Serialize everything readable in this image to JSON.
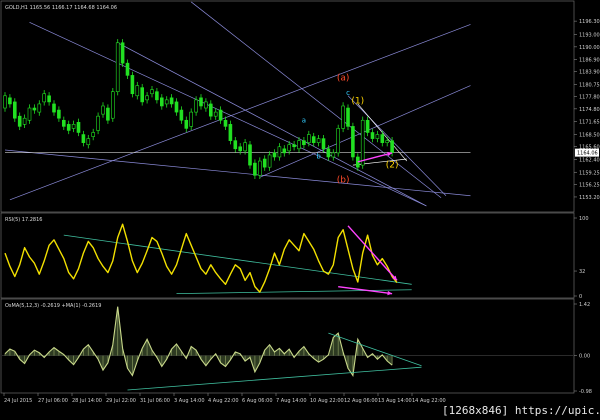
{
  "chart_data": [
    {
      "type": "candlestick",
      "title": "GOLD,H1  1165.56 1166.17 1164.68 1164.06",
      "ylim": [
        1150.0,
        1200.5
      ],
      "yticks": [
        1153.2,
        1156.25,
        1159.25,
        1162.4,
        1165.6,
        1168.5,
        1171.65,
        1174.8,
        1177.8,
        1180.75,
        1183.9,
        1186.9,
        1190.0,
        1193.0,
        1196.3
      ],
      "grid": false,
      "current_price": 1164.06,
      "current_price_label": "1164.06",
      "wave_labels": [
        {
          "text": "(a)",
          "color": "#ff4a2a",
          "bar": 69,
          "price": 1181.8
        },
        {
          "text": "c",
          "color": "#33ccff",
          "bar": 70,
          "price": 1178.2
        },
        {
          "text": "a",
          "color": "#33ccff",
          "bar": 61,
          "price": 1171.5
        },
        {
          "text": "b",
          "color": "#33ccff",
          "bar": 64,
          "price": 1162.6
        },
        {
          "text": "(b)",
          "color": "#ff4a2a",
          "bar": 69,
          "price": 1156.7
        },
        {
          "text": "(1)",
          "color": "#ffd400",
          "bar": 72,
          "price": 1176.1
        },
        {
          "text": "(2)",
          "color": "#ffd400",
          "bar": 79,
          "price": 1160.4
        }
      ],
      "bars": [
        {
          "o": 1175.0,
          "c": 1178.0
        },
        {
          "o": 1177.5,
          "c": 1176.0
        },
        {
          "o": 1176.5,
          "c": 1172.5
        },
        {
          "o": 1173.0,
          "c": 1170.5
        },
        {
          "o": 1171.0,
          "c": 1172.5
        },
        {
          "o": 1172.0,
          "c": 1175.0
        },
        {
          "o": 1175.0,
          "c": 1174.5
        },
        {
          "o": 1174.0,
          "c": 1176.0
        },
        {
          "o": 1176.5,
          "c": 1178.5
        },
        {
          "o": 1178.0,
          "c": 1176.5
        },
        {
          "o": 1176.0,
          "c": 1174.0
        },
        {
          "o": 1174.5,
          "c": 1172.5
        },
        {
          "o": 1172.0,
          "c": 1170.5
        },
        {
          "o": 1171.0,
          "c": 1169.5
        },
        {
          "o": 1170.0,
          "c": 1171.0
        },
        {
          "o": 1171.5,
          "c": 1169.0
        },
        {
          "o": 1168.5,
          "c": 1166.5
        },
        {
          "o": 1166.0,
          "c": 1167.5
        },
        {
          "o": 1168.0,
          "c": 1169.0
        },
        {
          "o": 1169.5,
          "c": 1173.0
        },
        {
          "o": 1173.5,
          "c": 1175.5
        },
        {
          "o": 1175.0,
          "c": 1172.0
        },
        {
          "o": 1172.5,
          "c": 1179.0
        },
        {
          "o": 1179.0,
          "c": 1191.0
        },
        {
          "o": 1191.0,
          "c": 1186.0
        },
        {
          "o": 1186.0,
          "c": 1183.0
        },
        {
          "o": 1183.0,
          "c": 1178.5
        },
        {
          "o": 1178.0,
          "c": 1180.5
        },
        {
          "o": 1180.0,
          "c": 1176.5
        },
        {
          "o": 1177.0,
          "c": 1178.0
        },
        {
          "o": 1178.5,
          "c": 1179.5
        },
        {
          "o": 1179.0,
          "c": 1177.0
        },
        {
          "o": 1177.5,
          "c": 1175.5
        },
        {
          "o": 1176.0,
          "c": 1177.0
        },
        {
          "o": 1177.5,
          "c": 1176.0
        },
        {
          "o": 1176.5,
          "c": 1174.0
        },
        {
          "o": 1174.5,
          "c": 1172.0
        },
        {
          "o": 1172.0,
          "c": 1170.0
        },
        {
          "o": 1170.5,
          "c": 1174.0
        },
        {
          "o": 1174.0,
          "c": 1177.0
        },
        {
          "o": 1177.5,
          "c": 1175.5
        },
        {
          "o": 1175.0,
          "c": 1176.5
        },
        {
          "o": 1176.0,
          "c": 1173.0
        },
        {
          "o": 1173.0,
          "c": 1174.0
        },
        {
          "o": 1174.5,
          "c": 1172.0
        },
        {
          "o": 1172.0,
          "c": 1170.5
        },
        {
          "o": 1171.0,
          "c": 1167.0
        },
        {
          "o": 1167.0,
          "c": 1165.0
        },
        {
          "o": 1165.5,
          "c": 1164.5
        },
        {
          "o": 1164.5,
          "c": 1166.5
        },
        {
          "o": 1166.0,
          "c": 1161.0
        },
        {
          "o": 1161.5,
          "c": 1158.5
        },
        {
          "o": 1158.5,
          "c": 1162.0
        },
        {
          "o": 1162.5,
          "c": 1160.5
        },
        {
          "o": 1160.5,
          "c": 1163.5
        },
        {
          "o": 1164.0,
          "c": 1163.0
        },
        {
          "o": 1163.0,
          "c": 1165.5
        },
        {
          "o": 1165.0,
          "c": 1164.0
        },
        {
          "o": 1164.5,
          "c": 1166.0
        },
        {
          "o": 1166.0,
          "c": 1165.5
        },
        {
          "o": 1165.0,
          "c": 1167.0
        },
        {
          "o": 1167.0,
          "c": 1166.0
        },
        {
          "o": 1166.5,
          "c": 1168.5
        },
        {
          "o": 1168.0,
          "c": 1166.5
        },
        {
          "o": 1166.5,
          "c": 1167.5
        },
        {
          "o": 1167.5,
          "c": 1165.0
        },
        {
          "o": 1165.0,
          "c": 1163.0
        },
        {
          "o": 1163.0,
          "c": 1164.0
        },
        {
          "o": 1164.0,
          "c": 1170.0
        },
        {
          "o": 1170.0,
          "c": 1175.5
        },
        {
          "o": 1175.0,
          "c": 1170.5
        },
        {
          "o": 1170.5,
          "c": 1163.0
        },
        {
          "o": 1163.0,
          "c": 1160.5
        },
        {
          "o": 1161.0,
          "c": 1172.0
        },
        {
          "o": 1172.0,
          "c": 1169.0
        },
        {
          "o": 1169.0,
          "c": 1167.5
        },
        {
          "o": 1167.5,
          "c": 1168.5
        },
        {
          "o": 1168.5,
          "c": 1166.5
        },
        {
          "o": 1166.5,
          "c": 1167.0
        },
        {
          "o": 1167.0,
          "c": 1164.06
        }
      ],
      "trendlines": [
        {
          "name": "fan-line-1",
          "color": "#8a8ad8",
          "from": {
            "bar": 5,
            "price": 1196.0
          },
          "to": {
            "bar": 86,
            "price": 1151.0
          }
        },
        {
          "name": "fan-line-2",
          "color": "#8a8ad8",
          "from": {
            "bar": 23,
            "price": 1191.0
          },
          "to": {
            "bar": 86,
            "price": 1151.0
          }
        },
        {
          "name": "fan-line-3",
          "color": "#8a8ad8",
          "from": {
            "bar": 38,
            "price": 1201.0
          },
          "to": {
            "bar": 89,
            "price": 1153.0
          }
        },
        {
          "name": "fan-line-4",
          "color": "#8a8ad8",
          "from": {
            "bar": 70,
            "price": 1178.0
          },
          "to": {
            "bar": 90,
            "price": 1153.5
          }
        },
        {
          "name": "rising-channel-upper",
          "color": "#8a8ad8",
          "from": {
            "bar": 1,
            "price": 1152.5
          },
          "to": {
            "bar": 95,
            "price": 1195.5
          }
        },
        {
          "name": "rising-channel-lower",
          "color": "#8a8ad8",
          "from": {
            "bar": 52,
            "price": 1158.0
          },
          "to": {
            "bar": 95,
            "price": 1180.5
          }
        },
        {
          "name": "descending-support",
          "color": "#8a8ad8",
          "from": {
            "bar": 0,
            "price": 1164.7
          },
          "to": {
            "bar": 95,
            "price": 1153.5
          }
        },
        {
          "name": "wave-1-upper",
          "color": "#ffffff",
          "from": {
            "bar": 72,
            "price": 1176.0
          },
          "to": {
            "bar": 82,
            "price": 1162.0
          }
        },
        {
          "name": "wave-1-lower",
          "color": "#ffffff",
          "from": {
            "bar": 71,
            "price": 1161.0
          },
          "to": {
            "bar": 82,
            "price": 1162.5
          }
        },
        {
          "name": "current-price-line",
          "color": "#d0d0d0",
          "from": {
            "bar": 0,
            "price": 1164.06
          },
          "to": {
            "bar": 95,
            "price": 1164.06
          }
        }
      ],
      "arrows": [
        {
          "name": "price-divergence-arrow",
          "color": "#ff44ff",
          "from": {
            "bar": 72,
            "price": 1161.8
          },
          "to": {
            "bar": 79,
            "price": 1164.0
          }
        }
      ]
    },
    {
      "type": "line",
      "title": "RSI(5) 17.2816",
      "ylim": [
        0,
        100
      ],
      "yticks": [
        0,
        32,
        100
      ],
      "series": [
        {
          "name": "RSI(5)",
          "color": "#f2e000",
          "values": [
            55,
            38,
            25,
            40,
            62,
            50,
            42,
            28,
            45,
            65,
            72,
            60,
            48,
            30,
            22,
            35,
            55,
            70,
            62,
            48,
            38,
            30,
            45,
            75,
            92,
            70,
            45,
            30,
            42,
            58,
            75,
            70,
            55,
            38,
            28,
            40,
            60,
            80,
            65,
            50,
            35,
            28,
            40,
            30,
            22,
            15,
            28,
            40,
            35,
            20,
            30,
            12,
            5,
            18,
            35,
            55,
            40,
            60,
            72,
            65,
            58,
            80,
            70,
            60,
            45,
            32,
            28,
            40,
            75,
            85,
            60,
            35,
            18,
            55,
            78,
            52,
            40,
            48,
            38,
            25,
            17.28
          ]
        }
      ],
      "arrows": [
        {
          "name": "rsi-divergence-arrow-upper",
          "color": "#ff44ff",
          "from": {
            "bar": 70,
            "value": 90
          },
          "to": {
            "bar": 80,
            "value": 20
          }
        },
        {
          "name": "rsi-divergence-arrow-lower",
          "color": "#ff44ff",
          "from": {
            "bar": 68,
            "value": 12
          },
          "to": {
            "bar": 79,
            "value": 3
          }
        }
      ],
      "trendlines": [
        {
          "name": "rsi-upper-trendline",
          "color": "#40c0a0",
          "from": {
            "bar": 12,
            "value": 78
          },
          "to": {
            "bar": 83,
            "value": 15
          }
        },
        {
          "name": "rsi-lower-trendline",
          "color": "#40c0a0",
          "from": {
            "bar": 35,
            "value": 3
          },
          "to": {
            "bar": 83,
            "value": 8
          }
        }
      ]
    },
    {
      "type": "area",
      "title": "OsMA(5,12,3) -0.2619  +MA(1) -0.2619",
      "ylim": [
        -0.9767,
        1.4236
      ],
      "yticks": [
        -0.9767,
        0.0,
        1.4236
      ],
      "series": [
        {
          "name": "OsMA(5,12,3)",
          "color": "#c8d88a",
          "values": [
            0.05,
            0.18,
            0.12,
            -0.1,
            -0.22,
            0.02,
            0.15,
            0.08,
            -0.05,
            0.1,
            0.22,
            0.12,
            0.03,
            -0.12,
            -0.25,
            -0.05,
            0.18,
            0.3,
            0.1,
            -0.1,
            -0.4,
            -0.2,
            0.3,
            1.35,
            0.2,
            -0.35,
            -0.55,
            -0.15,
            0.2,
            0.45,
            0.15,
            -0.05,
            -0.3,
            -0.1,
            0.18,
            0.32,
            0.12,
            -0.08,
            0.25,
            0.15,
            -0.1,
            -0.28,
            -0.1,
            0.05,
            -0.2,
            -0.3,
            -0.12,
            0.1,
            0.05,
            -0.15,
            -0.05,
            -0.45,
            -0.2,
            0.15,
            0.3,
            0.1,
            0.2,
            0.05,
            0.18,
            -0.05,
            0.12,
            0.25,
            0.05,
            -0.08,
            -0.18,
            -0.1,
            0.02,
            0.5,
            0.62,
            0.1,
            -0.35,
            -0.55,
            0.45,
            0.2,
            -0.05,
            0.05,
            -0.1,
            0.02,
            -0.15,
            -0.2619
          ]
        }
      ],
      "trendlines": [
        {
          "name": "osma-upper-trendline",
          "color": "#40c0a0",
          "from": {
            "bar": 66,
            "value": 0.62
          },
          "to": {
            "bar": 85,
            "value": -0.28
          }
        },
        {
          "name": "osma-lower-trendline",
          "color": "#40c0a0",
          "from": {
            "bar": 25,
            "value": -0.95
          },
          "to": {
            "bar": 85,
            "value": -0.32
          }
        }
      ]
    }
  ],
  "x_axis": {
    "tick_labels": [
      "24 Jul 2015",
      "27 Jul 06:00",
      "28 Jul 14:00",
      "29 Jul 22:00",
      "31 Jul 06:00",
      "3 Aug 14:00",
      "4 Aug 22:00",
      "6 Aug 06:00",
      "7 Aug 14:00",
      "10 Aug 22:00",
      "12 Aug 06:00",
      "13 Aug 14:00",
      "14 Aug 22:00"
    ]
  },
  "watermark": "[1268x846] https://upic.me/"
}
